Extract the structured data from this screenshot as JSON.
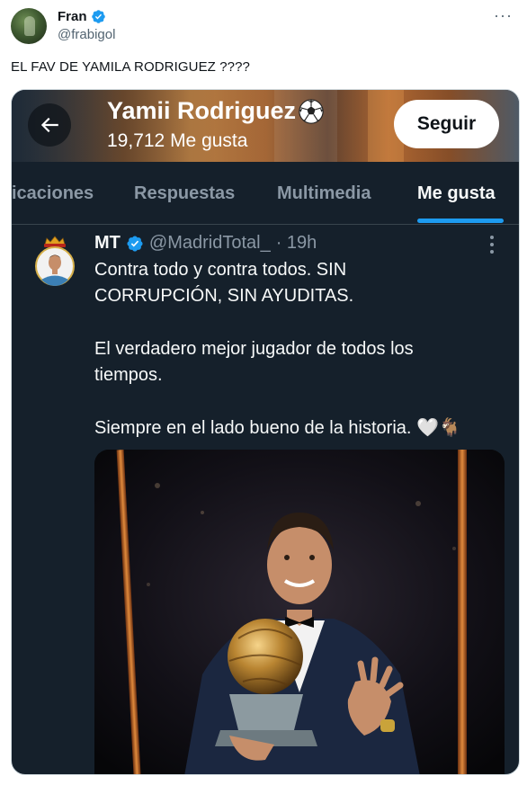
{
  "outer_tweet": {
    "author_name": "Fran",
    "author_handle": "@frabigol",
    "more_label": "···",
    "text": "EL FAV DE YAMILA RODRIGUEZ ????"
  },
  "profile": {
    "display_name": "Yamii Rodriguez",
    "likes_count": "19,712 Me gusta",
    "follow_label": "Seguir"
  },
  "tabs": [
    {
      "label": "icaciones"
    },
    {
      "label": "Respuestas"
    },
    {
      "label": "Multimedia"
    },
    {
      "label": "Me gusta",
      "active": true
    }
  ],
  "inner_tweet": {
    "author_name": "MT",
    "author_handle": "@MadridTotal_",
    "time": "· 19h",
    "lines": [
      "Contra todo y contra todos. SIN",
      "CORRUPCIÓN, SIN AYUDITAS.",
      "El verdadero mejor jugador de todos los",
      "tiempos.",
      "Siempre en el lado bueno de la historia. 🤍🐐"
    ]
  },
  "colors": {
    "accent": "#1d9bf0",
    "dark_bg": "#15202b",
    "muted_text": "#8b98a5"
  },
  "icons": [
    "verified-badge-icon",
    "back-arrow-icon",
    "soccer-ball-icon",
    "more-options-icon"
  ]
}
